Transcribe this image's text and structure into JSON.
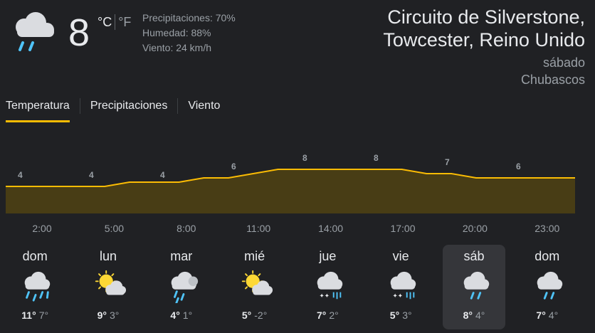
{
  "current": {
    "icon": "rain-cloud-icon",
    "temp": "8",
    "unit_c": "°C",
    "unit_f": "°F",
    "precip": "Precipitaciones: 70%",
    "humidity": "Humedad: 88%",
    "wind": "Viento: 24 km/h"
  },
  "location": {
    "line1": "Circuito de Silverstone,",
    "line2": "Towcester, Reino Unido",
    "day": "sábado",
    "condition": "Chubascos"
  },
  "tabs": [
    {
      "label": "Temperatura",
      "active": true
    },
    {
      "label": "Precipitaciones",
      "active": false
    },
    {
      "label": "Viento",
      "active": false
    }
  ],
  "chart_data": {
    "type": "area",
    "x": [
      "2:00",
      "3:00",
      "4:00",
      "5:00",
      "6:00",
      "7:00",
      "8:00",
      "9:00",
      "10:00",
      "11:00",
      "12:00",
      "13:00",
      "14:00",
      "15:00",
      "16:00",
      "17:00",
      "18:00",
      "19:00",
      "20:00",
      "21:00",
      "22:00",
      "23:00",
      "0:00",
      "1:00"
    ],
    "values": [
      4,
      4,
      4,
      4,
      4,
      5,
      5,
      5,
      6,
      6,
      7,
      8,
      8,
      8,
      8,
      8,
      8,
      7,
      7,
      6,
      6,
      6,
      6,
      6
    ],
    "labels": [
      {
        "x": "2:00",
        "value": "4"
      },
      {
        "x": "5:00",
        "value": "4"
      },
      {
        "x": "8:00",
        "value": "4"
      },
      {
        "x": "11:00",
        "value": "6"
      },
      {
        "x": "14:00",
        "value": "8"
      },
      {
        "x": "17:00",
        "value": "8"
      },
      {
        "x": "20:00",
        "value": "7"
      },
      {
        "x": "23:00",
        "value": "6"
      }
    ],
    "ticks": [
      "2:00",
      "5:00",
      "8:00",
      "11:00",
      "14:00",
      "17:00",
      "20:00",
      "23:00"
    ],
    "line_color": "#fbbc04",
    "fill_color": "#483d15"
  },
  "days": [
    {
      "name": "dom",
      "icon": "heavy-rain-icon",
      "hi": "11°",
      "lo": "7°",
      "selected": false
    },
    {
      "name": "lun",
      "icon": "partly-sunny-icon",
      "hi": "9°",
      "lo": "3°",
      "selected": false
    },
    {
      "name": "mar",
      "icon": "rain-sun-cloud-icon",
      "hi": "4°",
      "lo": "1°",
      "selected": false
    },
    {
      "name": "mié",
      "icon": "partly-sunny-icon",
      "hi": "5°",
      "lo": "-2°",
      "selected": false
    },
    {
      "name": "jue",
      "icon": "sleet-icon",
      "hi": "7°",
      "lo": "2°",
      "selected": false
    },
    {
      "name": "vie",
      "icon": "sleet-icon",
      "hi": "5°",
      "lo": "3°",
      "selected": false
    },
    {
      "name": "sáb",
      "icon": "rain-cloud-icon",
      "hi": "8°",
      "lo": "4°",
      "selected": true
    },
    {
      "name": "dom",
      "icon": "rain-cloud-icon",
      "hi": "7°",
      "lo": "4°",
      "selected": false
    }
  ]
}
